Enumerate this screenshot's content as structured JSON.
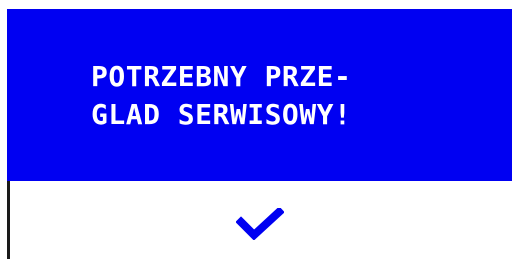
{
  "message": {
    "line1": "POTRZEBNY PRZE-",
    "line2": "GLAD SERWISOWY!"
  },
  "confirm": {
    "icon": "checkmark-icon"
  },
  "colors": {
    "panel": "#0000f2",
    "text": "#ffffff",
    "icon": "#0000f2",
    "background": "#ffffff"
  }
}
